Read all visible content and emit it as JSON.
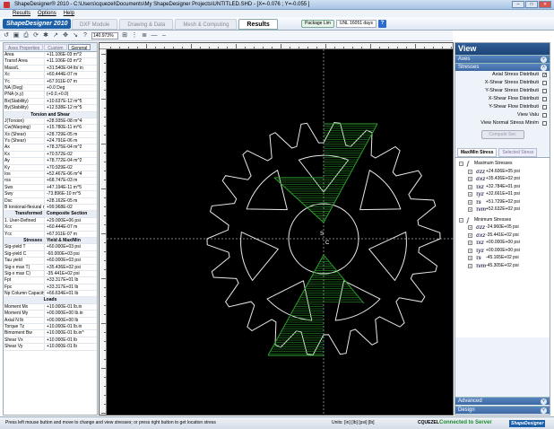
{
  "window": {
    "title": "ShapeDesigner® 2010 - C:\\Users\\cquezel\\Documents\\My ShapeDesigner Projects\\UNTITLED.SHD - [X=-0.076 ; Y=-0.055 ]"
  },
  "menu": [
    "Results",
    "Options",
    "Help"
  ],
  "logo": "ShapeDesigner 2010",
  "tabs": [
    "DXF Module",
    "Drawing & Data",
    "Mesh & Computing",
    "Results"
  ],
  "package": {
    "label": "Package Lim",
    "license": "UNL 16051 days"
  },
  "toolbar": {
    "zoom": "140.973%"
  },
  "left_tabs": [
    "Axes Properties",
    "Custom",
    "General"
  ],
  "properties": [
    {
      "k": "Area",
      "v": "+11.106E-03 m^2"
    },
    {
      "k": "Transf Area",
      "v": "+11.106E-03 m^2"
    },
    {
      "k": "Mass/L",
      "v": "+31.540E-04 lb/ in"
    },
    {
      "k": "Xc",
      "v": "+60.444E-07 m"
    },
    {
      "k": "Yc",
      "v": "+67.911E-07 m"
    },
    {
      "k": "NA (Deg)",
      "v": "+0.0 Deg"
    },
    {
      "k": "PNA (x,y)",
      "v": "(+0.0,+0.0)"
    },
    {
      "k": "Bx(Stability)",
      "v": "+10.637E-12 m^5"
    },
    {
      "k": "By(Stability)",
      "v": "+12.538E-12 m^5"
    },
    {
      "k": "Torsion and Shear",
      "v": "",
      "sec": true
    },
    {
      "k": "J(Torsion)",
      "v": "+28.935E-08 m^4"
    },
    {
      "k": "Cw(Warping)",
      "v": "+15.780E-11 m^6"
    },
    {
      "k": "Xs (Shear)",
      "v": "+28.729E-05 m"
    },
    {
      "k": "Ys (Shear)",
      "v": "+24.791E-06 m"
    },
    {
      "k": "Ax",
      "v": "+78.375E-04 m^2"
    },
    {
      "k": "Kx",
      "v": "+70.572E-02"
    },
    {
      "k": "Ay",
      "v": "+78.772E-04 m^2"
    },
    {
      "k": "Ky",
      "v": "+70.929E-02"
    },
    {
      "k": "Ios",
      "v": "+52.467E-06 m^4"
    },
    {
      "k": "ros",
      "v": "+68.747E-03 m"
    },
    {
      "k": "Swx",
      "v": "+47.194E-11 m^5"
    },
    {
      "k": "Swy",
      "v": "-73.896E-10 m^5"
    },
    {
      "k": "Dsc",
      "v": "+28.162E-05 m"
    },
    {
      "k": "B torsional-flexural r",
      "v": "+99.968E-02"
    },
    {
      "k": "Transformed",
      "v": "Composite Section",
      "sec2": true
    },
    {
      "k": "1. User-Defined",
      "v": "+29.000E+06 psi"
    },
    {
      "k": "Xcc",
      "v": "+60.444E-07 m"
    },
    {
      "k": "Ycc",
      "v": "+67.911E-07 m"
    },
    {
      "k": "Stresses",
      "v": "Yield & Max/Min",
      "sec2": true
    },
    {
      "k": "Sig-yield T",
      "v": "+60.000E+03 psi"
    },
    {
      "k": "Sig-yield C",
      "v": "-60.000E+03 psi"
    },
    {
      "k": "Tau yield",
      "v": "+60.000E+03 psi"
    },
    {
      "k": "Sig-x max T)",
      "v": "+35.436E+02 psi"
    },
    {
      "k": "Sig-x max C)",
      "v": "-35.441E+02 psi"
    },
    {
      "k": "Fpt",
      "v": "+33.317E+01 lb"
    },
    {
      "k": "Fpc",
      "v": "+33.317E+01 lb"
    },
    {
      "k": "Np Column Capacity",
      "v": "+66.634E+01 lb"
    },
    {
      "k": "Loads",
      "v": "",
      "sec": true
    },
    {
      "k": "Moment Mx",
      "v": "+10.000E-01 lb.in"
    },
    {
      "k": "Moment My",
      "v": "+00.000E+00 lb.in"
    },
    {
      "k": "Axial N lb",
      "v": "+00.000E+00 lb"
    },
    {
      "k": "Torque Tz",
      "v": "+10.000E-01 lb.in"
    },
    {
      "k": "Bimoment Bw",
      "v": "+10.000E-01 lb.in^"
    },
    {
      "k": "Shear Vx",
      "v": "+10.000E-01 lb"
    },
    {
      "k": "Shear Vy",
      "v": "+10.000E-01 lb"
    }
  ],
  "canvas": {
    "label_s": "S",
    "label_c": "C"
  },
  "right": {
    "header": "View",
    "axes": "Axes",
    "stresses": "Stresses",
    "options": [
      {
        "label": "Axial Stress Distributi",
        "checked": "✓"
      },
      {
        "label": "X-Shear Stress Distributi",
        "checked": ""
      },
      {
        "label": "Y-Shear Stress Distributi",
        "checked": ""
      },
      {
        "label": "X-Shear Flow Distributi",
        "checked": ""
      },
      {
        "label": "Y-Shear Flow Distributi",
        "checked": ""
      },
      {
        "label": "View Valu",
        "checked": ""
      },
      {
        "label": "View Normal Stress Min/m",
        "checked": ""
      }
    ],
    "compute_btn": "Compute Sec",
    "mm_tabs": [
      "Max/Min Stress",
      "Selected Stress"
    ],
    "max_title": "Maximum Stresses",
    "max_vals": [
      {
        "s": "σzz",
        "v": "+24.606E+05 psi"
      },
      {
        "s": "σxz",
        "v": "+35.436E+02 psi"
      },
      {
        "s": "τxz",
        "v": "+32.784E+01 psi"
      },
      {
        "s": "τyz",
        "v": "+32.661E+01 psi"
      },
      {
        "s": "τs",
        "v": "+51.729E+02 psi"
      },
      {
        "s": "τvm",
        "v": "+52.632E+02 psi"
      }
    ],
    "min_title": "Minimum Stresses",
    "min_vals": [
      {
        "s": "σzz",
        "v": "-24.960E+05 psi"
      },
      {
        "s": "σxz",
        "v": "-35.441E+02 psi"
      },
      {
        "s": "τxz",
        "v": "+00.000E+00 psi"
      },
      {
        "s": "τyz",
        "v": "+00.000E+00 psi"
      },
      {
        "s": "τs",
        "v": "-45.165E+02 psi"
      },
      {
        "s": "τvm",
        "v": "-45.305E+02 psi"
      }
    ],
    "advanced": "Advanced",
    "design": "Design"
  },
  "status": {
    "msg": "Press left mouse button and move to change and view stresses; or press right button to get location stress",
    "units": "Units: [in] [lb] [psi] [lb]",
    "user": "CQUEZEL",
    "conn": "Connected to Server",
    "logo": "ShapeDesigner"
  }
}
